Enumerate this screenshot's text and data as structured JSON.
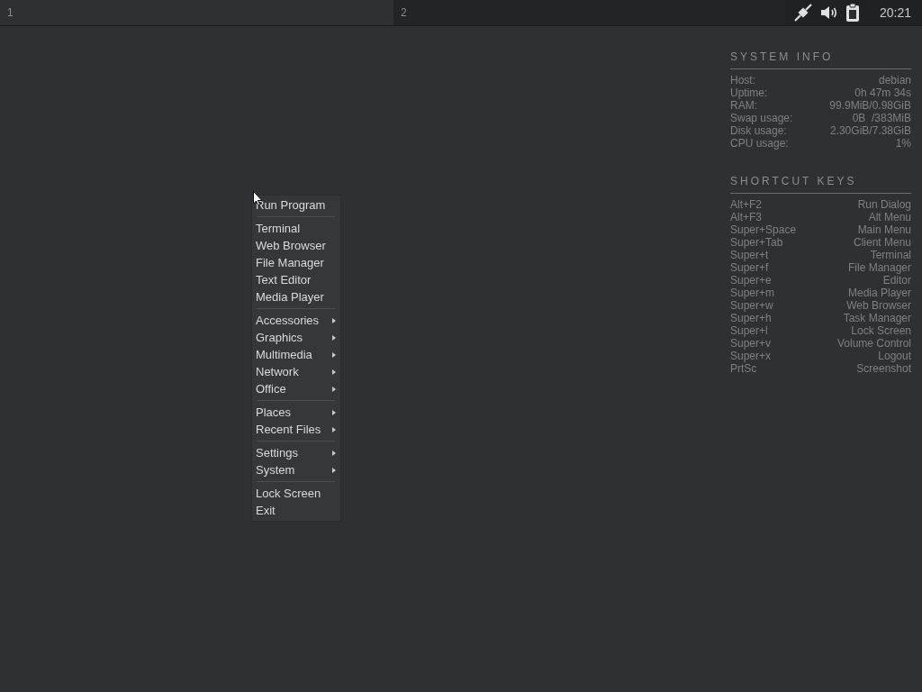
{
  "panel": {
    "workspaces": [
      {
        "label": "1",
        "selected": true
      },
      {
        "label": "2",
        "selected": false
      }
    ],
    "clock": "20:21"
  },
  "menu": {
    "groups": [
      [
        {
          "label": "Run Program",
          "submenu": false
        }
      ],
      [
        {
          "label": "Terminal",
          "submenu": false
        },
        {
          "label": "Web Browser",
          "submenu": false
        },
        {
          "label": "File Manager",
          "submenu": false
        },
        {
          "label": "Text Editor",
          "submenu": false
        },
        {
          "label": "Media Player",
          "submenu": false
        }
      ],
      [
        {
          "label": "Accessories",
          "submenu": true
        },
        {
          "label": "Graphics",
          "submenu": true
        },
        {
          "label": "Multimedia",
          "submenu": true
        },
        {
          "label": "Network",
          "submenu": true
        },
        {
          "label": "Office",
          "submenu": true
        }
      ],
      [
        {
          "label": "Places",
          "submenu": true
        },
        {
          "label": "Recent Files",
          "submenu": true
        }
      ],
      [
        {
          "label": "Settings",
          "submenu": true
        },
        {
          "label": "System",
          "submenu": true
        }
      ],
      [
        {
          "label": "Lock Screen",
          "submenu": false
        },
        {
          "label": "Exit",
          "submenu": false
        }
      ]
    ]
  },
  "system_info": {
    "title": "SYSTEM INFO",
    "rows": [
      {
        "label": "Host:",
        "value": "debian"
      },
      {
        "label": "Uptime:",
        "value": "0h 47m 34s"
      },
      {
        "label": "RAM:",
        "value": "99.9MiB/0.98GiB"
      },
      {
        "label": "Swap usage:",
        "value": "0B  /383MiB"
      },
      {
        "label": "Disk usage:",
        "value": "2.30GiB/7.38GiB"
      },
      {
        "label": "CPU usage:",
        "value": "1%"
      }
    ]
  },
  "shortcut_keys": {
    "title": "SHORTCUT KEYS",
    "rows": [
      {
        "label": "Alt+F2",
        "value": "Run Dialog"
      },
      {
        "label": "Alt+F3",
        "value": "Alt Menu"
      },
      {
        "label": "Super+Space",
        "value": "Main Menu"
      },
      {
        "label": "Super+Tab",
        "value": "Client Menu"
      },
      {
        "label": "Super+t",
        "value": "Terminal"
      },
      {
        "label": "Super+f",
        "value": "File Manager"
      },
      {
        "label": "Super+e",
        "value": "Editor"
      },
      {
        "label": "Super+m",
        "value": "Media Player"
      },
      {
        "label": "Super+w",
        "value": "Web Browser"
      },
      {
        "label": "Super+h",
        "value": "Task Manager"
      },
      {
        "label": "Super+l",
        "value": "Lock Screen"
      },
      {
        "label": "Super+v",
        "value": "Volume Control"
      },
      {
        "label": "Super+x",
        "value": "Logout"
      },
      {
        "label": "PrtSc",
        "value": "Screenshot"
      }
    ]
  }
}
